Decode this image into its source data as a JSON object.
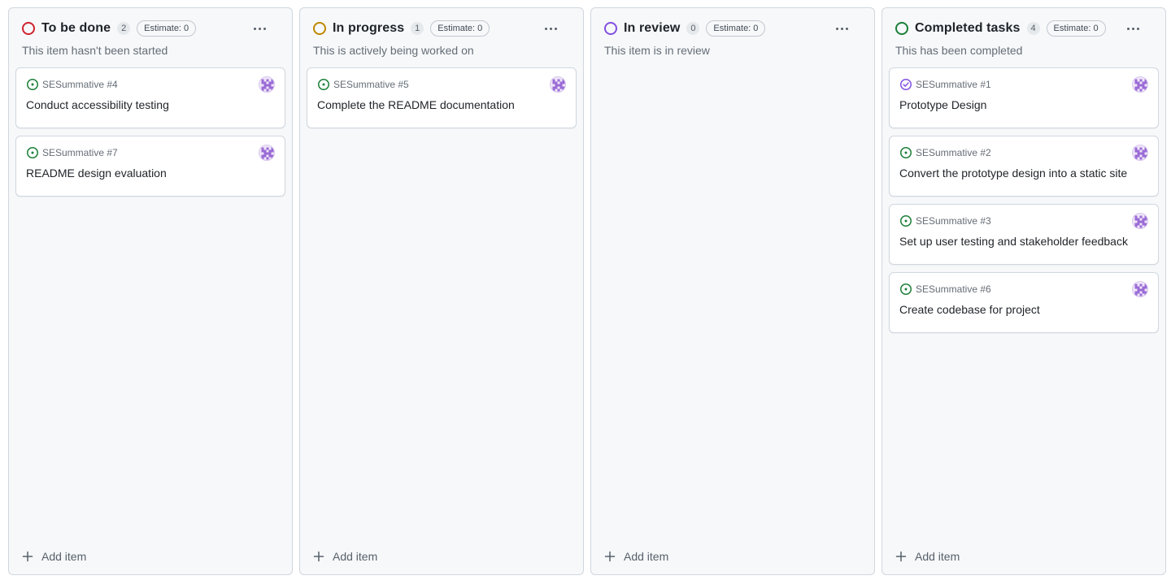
{
  "columns": [
    {
      "title": "To be done",
      "count": "2",
      "estimate": "Estimate: 0",
      "description": "This item hasn't been started",
      "status_color": "#cf222e",
      "cards": [
        {
          "ref": "SESummative #4",
          "title": "Conduct accessibility testing",
          "state": "open"
        },
        {
          "ref": "SESummative #7",
          "title": "README design evaluation",
          "state": "open"
        }
      ],
      "add_label": "Add item"
    },
    {
      "title": "In progress",
      "count": "1",
      "estimate": "Estimate: 0",
      "description": "This is actively being worked on",
      "status_color": "#bf8700",
      "cards": [
        {
          "ref": "SESummative #5",
          "title": "Complete the README documentation",
          "state": "open"
        }
      ],
      "add_label": "Add item"
    },
    {
      "title": "In review",
      "count": "0",
      "estimate": "Estimate: 0",
      "description": "This item is in review",
      "status_color": "#8250df",
      "cards": [],
      "add_label": "Add item"
    },
    {
      "title": "Completed tasks",
      "count": "4",
      "estimate": "Estimate: 0",
      "description": "This has been completed",
      "status_color": "#1a7f37",
      "cards": [
        {
          "ref": "SESummative #1",
          "title": "Prototype Design",
          "state": "closed"
        },
        {
          "ref": "SESummative #2",
          "title": "Convert the prototype design into a static site",
          "state": "open"
        },
        {
          "ref": "SESummative #3",
          "title": "Set up user testing and stakeholder feedback",
          "state": "open"
        },
        {
          "ref": "SESummative #6",
          "title": "Create codebase for project",
          "state": "open"
        }
      ],
      "add_label": "Add item"
    }
  ],
  "icons": {
    "open_issue": "issue-opened-icon",
    "closed_issue": "issue-closed-icon",
    "more": "kebab-horizontal-icon",
    "add": "plus-icon",
    "avatar": "identicon-avatar"
  },
  "colors": {
    "open_issue": "#1a7f37",
    "closed_issue": "#8250df",
    "avatar": "#9a6bd6"
  }
}
